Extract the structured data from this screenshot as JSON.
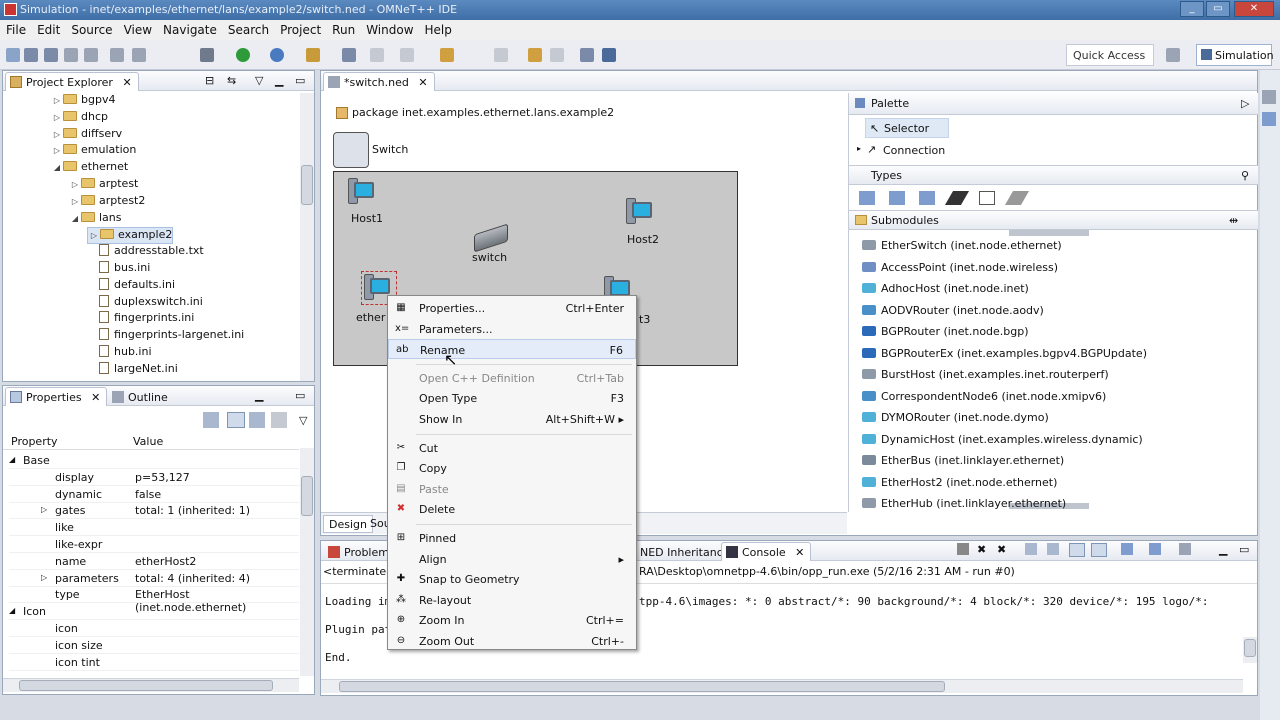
{
  "window": {
    "title": "Simulation - inet/examples/ethernet/lans/example2/switch.ned - OMNeT++ IDE"
  },
  "menubar": [
    "File",
    "Edit",
    "Source",
    "View",
    "Navigate",
    "Search",
    "Project",
    "Run",
    "Window",
    "Help"
  ],
  "toolbar": {
    "quick_access": "Quick Access",
    "perspective": "Simulation"
  },
  "project_explorer": {
    "tab": "Project Explorer",
    "items": [
      {
        "label": "bgpv4",
        "type": "folder",
        "indent": 1
      },
      {
        "label": "dhcp",
        "type": "folder",
        "indent": 1
      },
      {
        "label": "diffserv",
        "type": "folder",
        "indent": 1
      },
      {
        "label": "emulation",
        "type": "folder",
        "indent": 1
      },
      {
        "label": "ethernet",
        "type": "folder",
        "indent": 1,
        "open": true
      },
      {
        "label": "arptest",
        "type": "folder",
        "indent": 2
      },
      {
        "label": "arptest2",
        "type": "folder",
        "indent": 2
      },
      {
        "label": "lans",
        "type": "folder",
        "indent": 2,
        "open": true
      },
      {
        "label": "example2",
        "type": "folder",
        "indent": 3,
        "selected": true
      },
      {
        "label": "addresstable.txt",
        "type": "file",
        "indent": 3
      },
      {
        "label": "bus.ini",
        "type": "file",
        "indent": 3
      },
      {
        "label": "defaults.ini",
        "type": "file",
        "indent": 3
      },
      {
        "label": "duplexswitch.ini",
        "type": "file",
        "indent": 3
      },
      {
        "label": "fingerprints.ini",
        "type": "file",
        "indent": 3
      },
      {
        "label": "fingerprints-largenet.ini",
        "type": "file",
        "indent": 3
      },
      {
        "label": "hub.ini",
        "type": "file",
        "indent": 3
      },
      {
        "label": "largeNet.ini",
        "type": "file",
        "indent": 3
      }
    ]
  },
  "properties": {
    "tab": "Properties",
    "outline_tab": "Outline",
    "col_property": "Property",
    "col_value": "Value",
    "rows": [
      {
        "k": "Base",
        "v": "",
        "level": 0,
        "group": true
      },
      {
        "k": "display",
        "v": "p=53,127",
        "level": 1
      },
      {
        "k": "dynamic",
        "v": "false",
        "level": 1
      },
      {
        "k": "gates",
        "v": "total: 1 (inherited: 1)",
        "level": 1,
        "expand": true
      },
      {
        "k": "like",
        "v": "",
        "level": 1
      },
      {
        "k": "like-expr",
        "v": "",
        "level": 1
      },
      {
        "k": "name",
        "v": "etherHost2",
        "level": 1
      },
      {
        "k": "parameters",
        "v": "total: 4 (inherited: 4)",
        "level": 1,
        "expand": true
      },
      {
        "k": "type",
        "v": "EtherHost (inet.node.ethernet)",
        "level": 1
      },
      {
        "k": "Icon",
        "v": "",
        "level": 0,
        "group": true
      },
      {
        "k": "icon",
        "v": "",
        "level": 1
      },
      {
        "k": "icon size",
        "v": "",
        "level": 1
      },
      {
        "k": "icon tint",
        "v": "",
        "level": 1
      }
    ]
  },
  "editor": {
    "tab": "*switch.ned",
    "package": "package inet.examples.ethernet.lans.example2",
    "module": "Switch",
    "nodes": {
      "host1": "Host1",
      "host2": "Host2",
      "switch": "switch",
      "host3_partial": "t3",
      "etherhost_partial": "ether"
    },
    "bottom_tabs": [
      "Design",
      "Sou"
    ]
  },
  "context_menu": [
    {
      "label": "Properties...",
      "shortcut": "Ctrl+Enter",
      "icon": "properties-icon",
      "glyph": "▦"
    },
    {
      "label": "Parameters...",
      "shortcut": "",
      "icon": "parameters-icon",
      "glyph": "x="
    },
    {
      "label": "Rename",
      "shortcut": "F6",
      "icon": "rename-icon",
      "glyph": "ab",
      "hl": true
    },
    {
      "sep": true
    },
    {
      "label": "Open C++ Definition",
      "shortcut": "Ctrl+Tab",
      "disabled": true
    },
    {
      "label": "Open Type",
      "shortcut": "F3"
    },
    {
      "label": "Show In",
      "shortcut": "Alt+Shift+W ▸"
    },
    {
      "sep": true
    },
    {
      "label": "Cut",
      "shortcut": "",
      "icon": "cut-icon",
      "glyph": "✂"
    },
    {
      "label": "Copy",
      "shortcut": "",
      "icon": "copy-icon",
      "glyph": "❐"
    },
    {
      "label": "Paste",
      "shortcut": "",
      "icon": "paste-icon",
      "glyph": "▤",
      "disabled": true
    },
    {
      "label": "Delete",
      "shortcut": "",
      "icon": "delete-icon",
      "glyph": "✖",
      "red": true
    },
    {
      "sep": true
    },
    {
      "label": "Pinned",
      "shortcut": "",
      "icon": "pin-icon",
      "glyph": "⊞"
    },
    {
      "label": "Align",
      "shortcut": "▸"
    },
    {
      "label": "Snap to Geometry",
      "shortcut": "",
      "icon": "snap-icon",
      "glyph": "✚"
    },
    {
      "label": "Re-layout",
      "shortcut": "",
      "icon": "relayout-icon",
      "glyph": "⁂"
    },
    {
      "label": "Zoom In",
      "shortcut": "Ctrl+=",
      "icon": "zoom-in-icon",
      "glyph": "⊕"
    },
    {
      "label": "Zoom Out",
      "shortcut": "Ctrl+-",
      "icon": "zoom-out-icon",
      "glyph": "⊖"
    }
  ],
  "palette": {
    "title": "Palette",
    "selector": "Selector",
    "connection": "Connection",
    "types": "Types",
    "submodules": "Submodules",
    "items": [
      "EtherSwitch (inet.node.ethernet)",
      "AccessPoint (inet.node.wireless)",
      "AdhocHost (inet.node.inet)",
      "AODVRouter (inet.node.aodv)",
      "BGPRouter (inet.node.bgp)",
      "BGPRouterEx (inet.examples.bgpv4.BGPUpdate)",
      "BurstHost (inet.examples.inet.routerperf)",
      "CorrespondentNode6 (inet.node.xmipv6)",
      "DYMORouter (inet.node.dymo)",
      "DynamicHost (inet.examples.wireless.dynamic)",
      "EtherBus (inet.linklayer.ethernet)",
      "EtherHost2 (inet.node.ethernet)",
      "EtherHub (inet.linklayer.ethernet)"
    ]
  },
  "console": {
    "tabs": [
      "Problems",
      "NED Inheritance",
      "Console"
    ],
    "terminated": "<terminated>",
    "path": "RA\\Desktop\\omnetpp-4.6\\bin/opp_run.exe (5/2/16 2:31 AM - run #0)",
    "line1_left": "Loading im",
    "line1_right": "tpp-4.6\\images: *: 0  abstract/*: 90  background/*: 4  block/*: 320  device/*: 195  logo/*:",
    "line2": "Plugin pat",
    "line3": "End."
  }
}
